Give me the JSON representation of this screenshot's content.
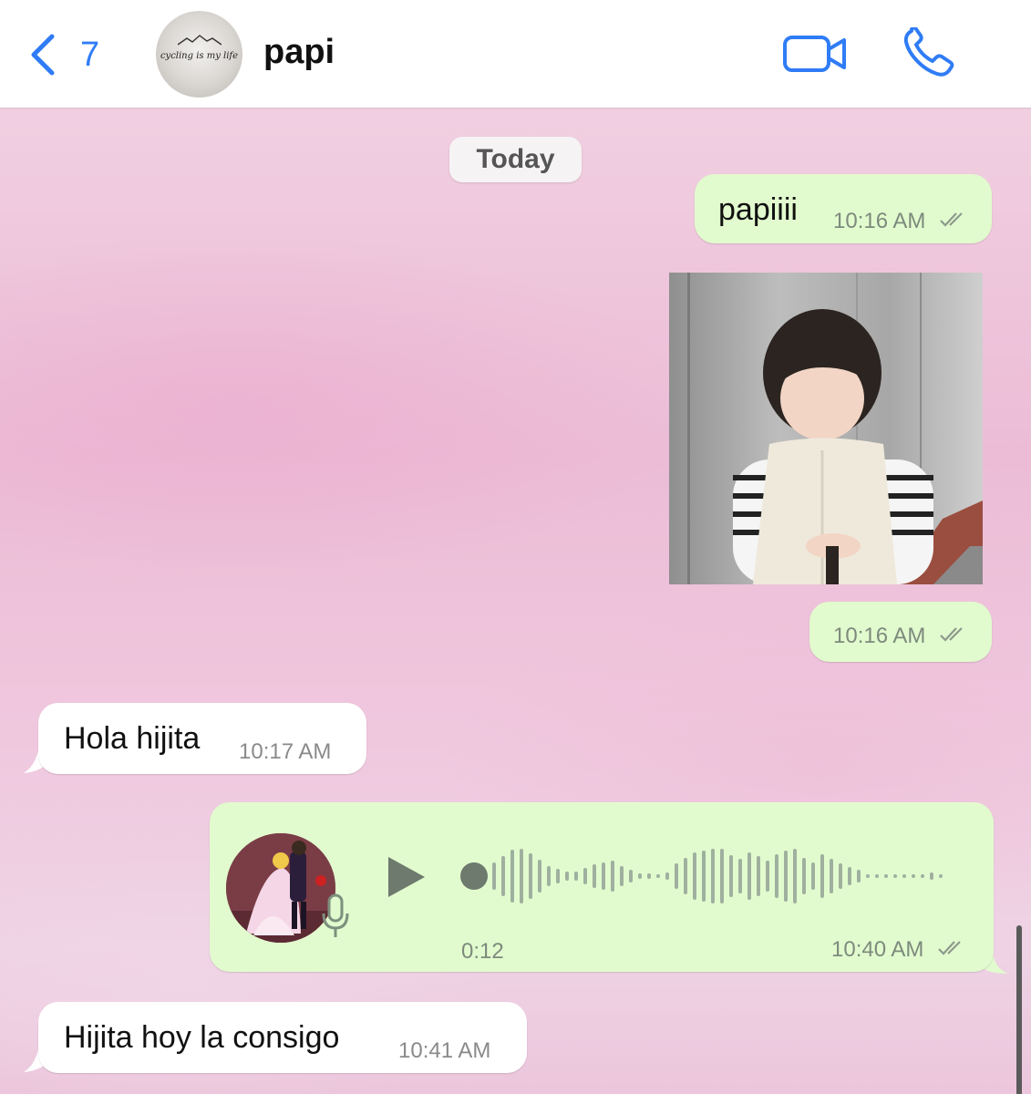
{
  "header": {
    "back_count": "7",
    "contact_name": "papi",
    "avatar_text": "cycling is my life",
    "accent_color": "#2f7cf6",
    "icons": [
      "chevron-left-icon",
      "video-call-icon",
      "phone-icon"
    ]
  },
  "chat": {
    "date_label": "Today",
    "messages": [
      {
        "direction": "out",
        "type": "text",
        "text": "papiiii",
        "time": "10:16 AM",
        "status": "read"
      },
      {
        "direction": "out",
        "type": "image",
        "time": "10:16 AM",
        "status": "read"
      },
      {
        "direction": "in",
        "type": "text",
        "text": "Hola hijita",
        "time": "10:17 AM"
      },
      {
        "direction": "out",
        "type": "voice",
        "duration": "0:12",
        "time": "10:40 AM",
        "status": "read"
      },
      {
        "direction": "in",
        "type": "text",
        "text": "Hijita hoy la consigo",
        "time": "10:41 AM"
      }
    ]
  },
  "colors": {
    "outgoing_bubble": "#e2fbce",
    "incoming_bubble": "#ffffff",
    "wallpaper": "#efc4dc"
  }
}
